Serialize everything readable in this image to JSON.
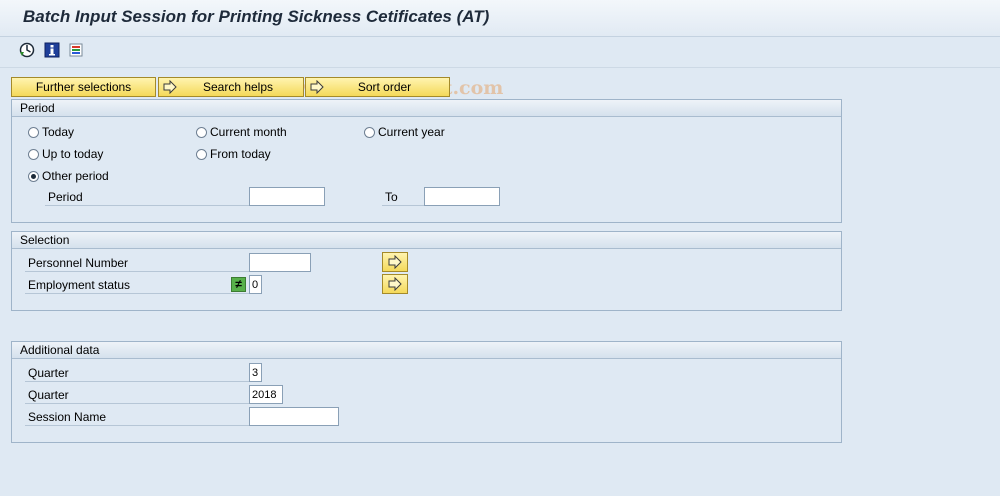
{
  "title": "Batch Input Session for Printing Sickness Cetificates (AT)",
  "watermark": "© www.tutorialkart.com",
  "toolbar": {
    "icons": [
      "execute-icon",
      "information-icon",
      "get-variant-icon"
    ]
  },
  "buttons": {
    "further_selections": "Further selections",
    "search_helps": "Search helps",
    "sort_order": "Sort order"
  },
  "period": {
    "header": "Period",
    "options": [
      {
        "label": "Today",
        "selected": false
      },
      {
        "label": "Current month",
        "selected": false
      },
      {
        "label": "Current year",
        "selected": false
      },
      {
        "label": "Up to today",
        "selected": false
      },
      {
        "label": "From today",
        "selected": false
      },
      {
        "label": "Other period",
        "selected": true
      }
    ],
    "period_label": "Period",
    "period_from": "",
    "to_label": "To",
    "period_to": ""
  },
  "selection": {
    "header": "Selection",
    "personnel_label": "Personnel Number",
    "personnel_value": "",
    "employment_label": "Employment status",
    "employment_operator": "≠",
    "employment_value": "0"
  },
  "additional": {
    "header": "Additional data",
    "quarter_label": "Quarter",
    "quarter_value": "3",
    "year_label": "Quarter",
    "year_value": "2018",
    "session_label": "Session Name",
    "session_value": ""
  },
  "colors": {
    "background": "#dfe9f3",
    "button_yellow": "#f4d95a",
    "title_text": "#1e2a3a"
  }
}
